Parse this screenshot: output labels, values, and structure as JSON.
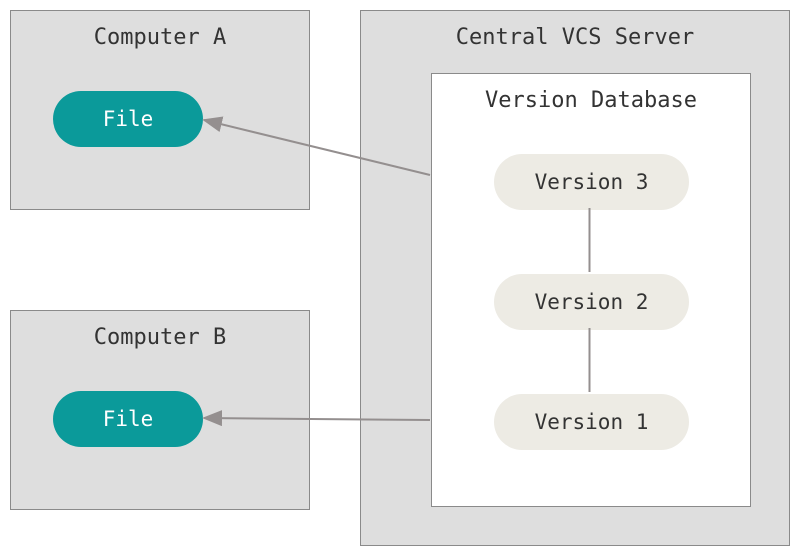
{
  "computer_a": {
    "title": "Computer A",
    "file_label": "File"
  },
  "computer_b": {
    "title": "Computer B",
    "file_label": "File"
  },
  "server": {
    "title": "Central VCS Server",
    "database": {
      "title": "Version Database",
      "versions": {
        "v3": "Version 3",
        "v2": "Version 2",
        "v1": "Version 1"
      }
    }
  },
  "colors": {
    "box_bg": "#dedede",
    "box_border": "#8a8a8a",
    "file_pill": "#0b9a9a",
    "version_pill": "#edebe4",
    "arrow": "#948f8f"
  }
}
